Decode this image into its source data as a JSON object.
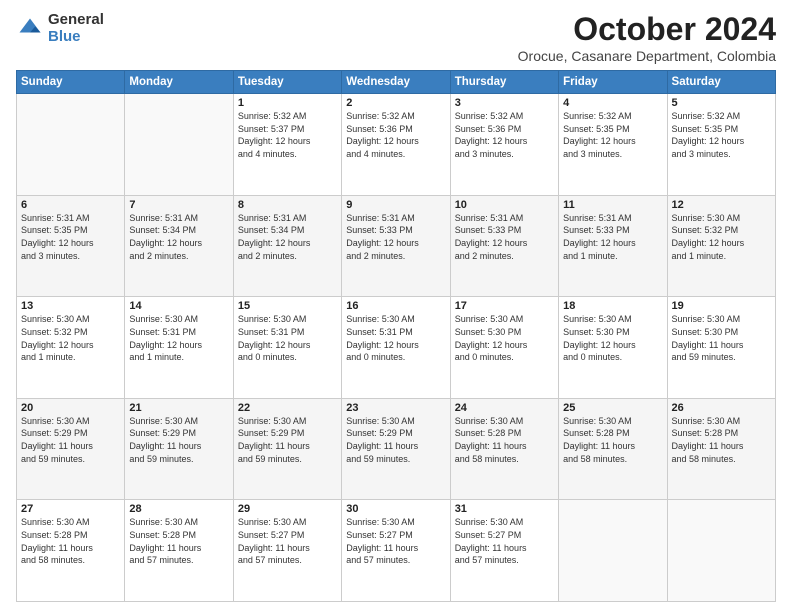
{
  "logo": {
    "general": "General",
    "blue": "Blue"
  },
  "header": {
    "month": "October 2024",
    "location": "Orocue, Casanare Department, Colombia"
  },
  "days_of_week": [
    "Sunday",
    "Monday",
    "Tuesday",
    "Wednesday",
    "Thursday",
    "Friday",
    "Saturday"
  ],
  "weeks": [
    [
      {
        "day": "",
        "info": ""
      },
      {
        "day": "",
        "info": ""
      },
      {
        "day": "1",
        "info": "Sunrise: 5:32 AM\nSunset: 5:37 PM\nDaylight: 12 hours\nand 4 minutes."
      },
      {
        "day": "2",
        "info": "Sunrise: 5:32 AM\nSunset: 5:36 PM\nDaylight: 12 hours\nand 4 minutes."
      },
      {
        "day": "3",
        "info": "Sunrise: 5:32 AM\nSunset: 5:36 PM\nDaylight: 12 hours\nand 3 minutes."
      },
      {
        "day": "4",
        "info": "Sunrise: 5:32 AM\nSunset: 5:35 PM\nDaylight: 12 hours\nand 3 minutes."
      },
      {
        "day": "5",
        "info": "Sunrise: 5:32 AM\nSunset: 5:35 PM\nDaylight: 12 hours\nand 3 minutes."
      }
    ],
    [
      {
        "day": "6",
        "info": "Sunrise: 5:31 AM\nSunset: 5:35 PM\nDaylight: 12 hours\nand 3 minutes."
      },
      {
        "day": "7",
        "info": "Sunrise: 5:31 AM\nSunset: 5:34 PM\nDaylight: 12 hours\nand 2 minutes."
      },
      {
        "day": "8",
        "info": "Sunrise: 5:31 AM\nSunset: 5:34 PM\nDaylight: 12 hours\nand 2 minutes."
      },
      {
        "day": "9",
        "info": "Sunrise: 5:31 AM\nSunset: 5:33 PM\nDaylight: 12 hours\nand 2 minutes."
      },
      {
        "day": "10",
        "info": "Sunrise: 5:31 AM\nSunset: 5:33 PM\nDaylight: 12 hours\nand 2 minutes."
      },
      {
        "day": "11",
        "info": "Sunrise: 5:31 AM\nSunset: 5:33 PM\nDaylight: 12 hours\nand 1 minute."
      },
      {
        "day": "12",
        "info": "Sunrise: 5:30 AM\nSunset: 5:32 PM\nDaylight: 12 hours\nand 1 minute."
      }
    ],
    [
      {
        "day": "13",
        "info": "Sunrise: 5:30 AM\nSunset: 5:32 PM\nDaylight: 12 hours\nand 1 minute."
      },
      {
        "day": "14",
        "info": "Sunrise: 5:30 AM\nSunset: 5:31 PM\nDaylight: 12 hours\nand 1 minute."
      },
      {
        "day": "15",
        "info": "Sunrise: 5:30 AM\nSunset: 5:31 PM\nDaylight: 12 hours\nand 0 minutes."
      },
      {
        "day": "16",
        "info": "Sunrise: 5:30 AM\nSunset: 5:31 PM\nDaylight: 12 hours\nand 0 minutes."
      },
      {
        "day": "17",
        "info": "Sunrise: 5:30 AM\nSunset: 5:30 PM\nDaylight: 12 hours\nand 0 minutes."
      },
      {
        "day": "18",
        "info": "Sunrise: 5:30 AM\nSunset: 5:30 PM\nDaylight: 12 hours\nand 0 minutes."
      },
      {
        "day": "19",
        "info": "Sunrise: 5:30 AM\nSunset: 5:30 PM\nDaylight: 11 hours\nand 59 minutes."
      }
    ],
    [
      {
        "day": "20",
        "info": "Sunrise: 5:30 AM\nSunset: 5:29 PM\nDaylight: 11 hours\nand 59 minutes."
      },
      {
        "day": "21",
        "info": "Sunrise: 5:30 AM\nSunset: 5:29 PM\nDaylight: 11 hours\nand 59 minutes."
      },
      {
        "day": "22",
        "info": "Sunrise: 5:30 AM\nSunset: 5:29 PM\nDaylight: 11 hours\nand 59 minutes."
      },
      {
        "day": "23",
        "info": "Sunrise: 5:30 AM\nSunset: 5:29 PM\nDaylight: 11 hours\nand 59 minutes."
      },
      {
        "day": "24",
        "info": "Sunrise: 5:30 AM\nSunset: 5:28 PM\nDaylight: 11 hours\nand 58 minutes."
      },
      {
        "day": "25",
        "info": "Sunrise: 5:30 AM\nSunset: 5:28 PM\nDaylight: 11 hours\nand 58 minutes."
      },
      {
        "day": "26",
        "info": "Sunrise: 5:30 AM\nSunset: 5:28 PM\nDaylight: 11 hours\nand 58 minutes."
      }
    ],
    [
      {
        "day": "27",
        "info": "Sunrise: 5:30 AM\nSunset: 5:28 PM\nDaylight: 11 hours\nand 58 minutes."
      },
      {
        "day": "28",
        "info": "Sunrise: 5:30 AM\nSunset: 5:28 PM\nDaylight: 11 hours\nand 57 minutes."
      },
      {
        "day": "29",
        "info": "Sunrise: 5:30 AM\nSunset: 5:27 PM\nDaylight: 11 hours\nand 57 minutes."
      },
      {
        "day": "30",
        "info": "Sunrise: 5:30 AM\nSunset: 5:27 PM\nDaylight: 11 hours\nand 57 minutes."
      },
      {
        "day": "31",
        "info": "Sunrise: 5:30 AM\nSunset: 5:27 PM\nDaylight: 11 hours\nand 57 minutes."
      },
      {
        "day": "",
        "info": ""
      },
      {
        "day": "",
        "info": ""
      }
    ]
  ]
}
